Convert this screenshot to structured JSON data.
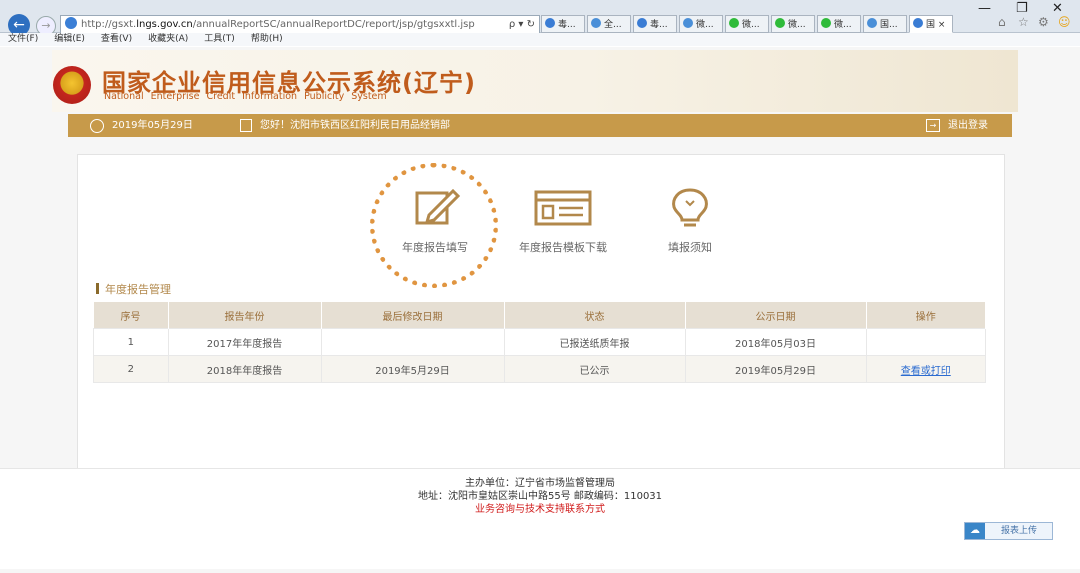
{
  "browser": {
    "url_prefix": "http://gsxt.",
    "url_domain": "lngs.gov.cn",
    "url_rest": "/annualReportSC/annualReportDC/report/jsp/gtgsxxtl.jsp",
    "url_controls": "ρ ▾ ↻",
    "tabs": [
      {
        "label": "毒...",
        "color": "#3a7cd4"
      },
      {
        "label": "全...",
        "color": "#4a8fd8"
      },
      {
        "label": "毒...",
        "color": "#3a7cd4"
      },
      {
        "label": "微...",
        "color": "#4a8fd8"
      },
      {
        "label": "微...",
        "color": "#2fbb3a"
      },
      {
        "label": "微...",
        "color": "#2fbb3a"
      },
      {
        "label": "微...",
        "color": "#2fbb3a"
      },
      {
        "label": "国...",
        "color": "#4a8fd8"
      },
      {
        "label": "国 ×",
        "color": "#3a7cd4"
      }
    ],
    "window_controls": [
      "—",
      "❐",
      "✕"
    ],
    "right_icons": [
      "⌂",
      "☆",
      "⚙",
      "☺"
    ],
    "menu": [
      "文件(F)",
      "编辑(E)",
      "查看(V)",
      "收藏夹(A)",
      "工具(T)",
      "帮助(H)"
    ]
  },
  "header": {
    "title": "国家企业信用信息公示系统(辽宁)",
    "subtitle": "National  Enterprise  Credit  Information  Publicity  System"
  },
  "status": {
    "date": "2019年05月29日",
    "greeting": "您好！沈阳市铁西区红阳利民日用品经销部",
    "logout": "退出登录"
  },
  "actions": [
    {
      "label": "年度报告填写",
      "icon": "edit-icon"
    },
    {
      "label": "年度报告模板下载",
      "icon": "template-icon"
    },
    {
      "label": "填报须知",
      "icon": "lightbulb-icon"
    }
  ],
  "section_title": "年度报告管理",
  "table": {
    "headers": [
      "序号",
      "报告年份",
      "最后修改日期",
      "状态",
      "公示日期",
      "操作"
    ],
    "rows": [
      [
        "1",
        "2017年年度报告",
        "",
        "已报送纸质年报",
        "2018年05月03日",
        ""
      ],
      [
        "2",
        "2018年年度报告",
        "2019年5月29日",
        "已公示",
        "2019年05月29日",
        "查看或打印"
      ]
    ]
  },
  "footer": {
    "sponsor": "主办单位：辽宁省市场监督管理局",
    "address": "地址：沈阳市皇姑区崇山中路55号 邮政编码：110031",
    "contact": "业务咨询与技术支持联系方式"
  },
  "upload_label": "报表上传"
}
